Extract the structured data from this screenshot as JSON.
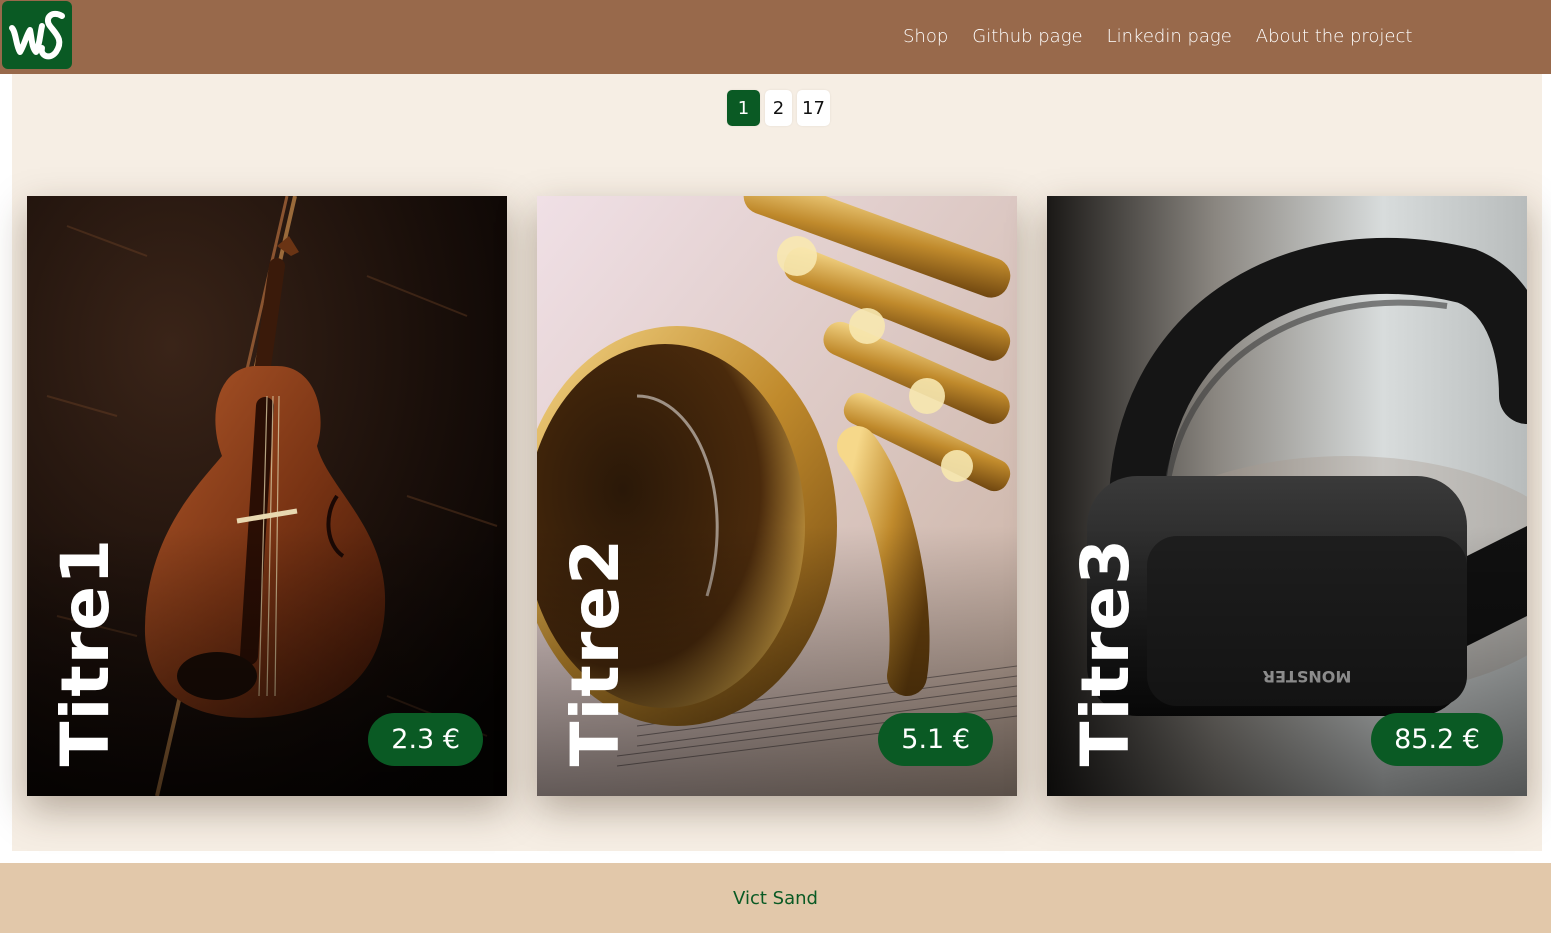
{
  "header": {
    "logo_text": "vS",
    "nav": [
      {
        "label": "Shop"
      },
      {
        "label": "Github page"
      },
      {
        "label": "Linkedin page"
      },
      {
        "label": "About the project"
      }
    ]
  },
  "pagination": {
    "pages": [
      "1",
      "2",
      "17"
    ],
    "current": "1"
  },
  "cards": [
    {
      "title": "Titre1",
      "price": "2.3 €",
      "image": "violin"
    },
    {
      "title": "Titre2",
      "price": "5.1 €",
      "image": "saxophone"
    },
    {
      "title": "Titre3",
      "price": "85.2 €",
      "image": "headphones",
      "image_brand_text": "MONSTER"
    }
  ],
  "footer": {
    "author": "Vict Sand"
  },
  "colors": {
    "header_bg": "#98694b",
    "brand_green": "#0a5a24",
    "main_bg": "#f6eee4",
    "footer_bg": "#e2c8aa"
  }
}
